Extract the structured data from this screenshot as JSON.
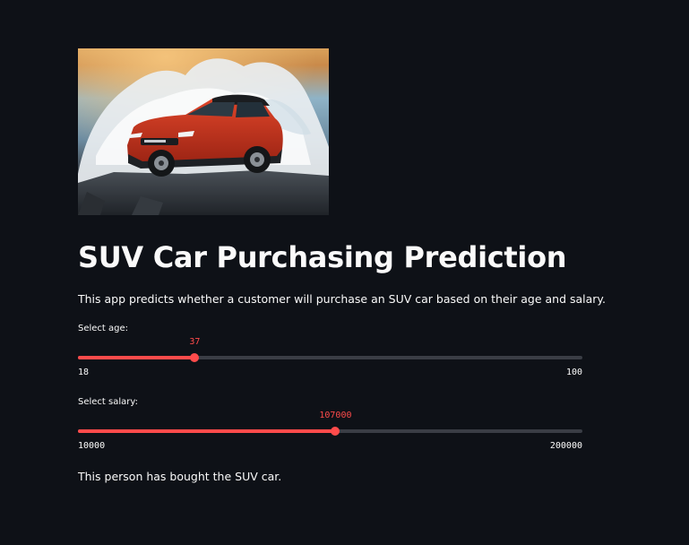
{
  "app": {
    "title": "SUV Car Purchasing Prediction",
    "description": "This app predicts whether a customer will purchase an SUV car based on their age and salary.",
    "hero_image": "red-suv-on-rocks-with-wave-splash",
    "accent_color": "#ff4b4b",
    "background_color": "#0e1117"
  },
  "age_slider": {
    "label": "Select age:",
    "value": 37,
    "min": 18,
    "max": 100,
    "value_text": "37",
    "min_text": "18",
    "max_text": "100"
  },
  "salary_slider": {
    "label": "Select salary:",
    "value": 107000,
    "min": 10000,
    "max": 200000,
    "value_text": "107000",
    "min_text": "10000",
    "max_text": "200000"
  },
  "result": {
    "text": "This person has bought the SUV car."
  }
}
